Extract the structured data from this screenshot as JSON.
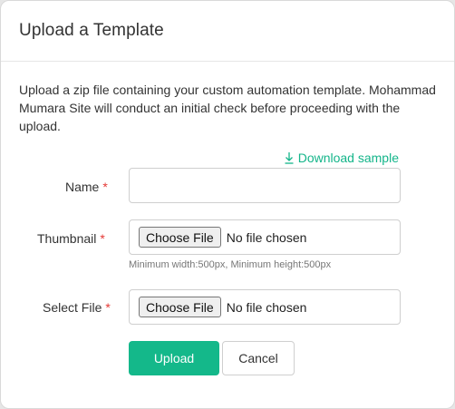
{
  "modal": {
    "title": "Upload a Template",
    "description": "Upload a zip file containing your custom automation template. Mohammad Mumara Site will conduct an initial check before proceeding with the upload."
  },
  "download_link": {
    "label": "Download sample",
    "icon": "download-icon"
  },
  "form": {
    "required_marker": "*",
    "name": {
      "label": "Name",
      "value": "",
      "placeholder": ""
    },
    "thumbnail": {
      "label": "Thumbnail",
      "button_label": "Choose File",
      "status": "No file chosen",
      "hint": "Minimum width:500px, Minimum height:500px"
    },
    "select_file": {
      "label": "Select File",
      "button_label": "Choose File",
      "status": "No file chosen"
    }
  },
  "actions": {
    "upload_label": "Upload",
    "cancel_label": "Cancel"
  },
  "colors": {
    "accent": "#14b88a",
    "required": "#e53935"
  }
}
